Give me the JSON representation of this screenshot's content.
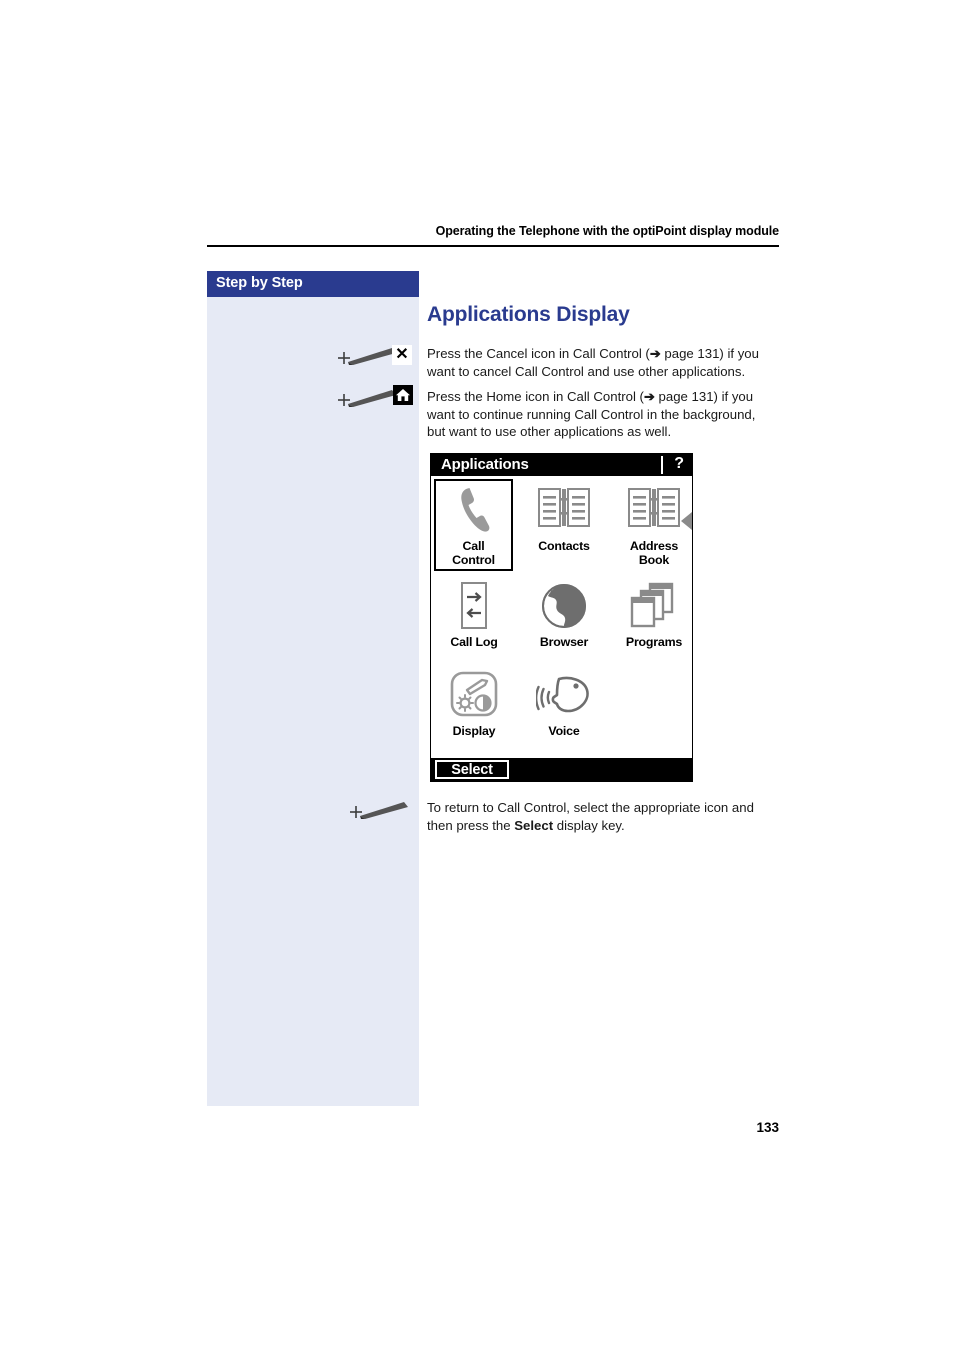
{
  "document": {
    "running_head": "Operating the Telephone with the optiPoint display module",
    "page_number": "133"
  },
  "sidebar": {
    "header_label": "Step by Step"
  },
  "main": {
    "title": "Applications Display",
    "instructions": [
      {
        "icon": "cancel-x-icon",
        "text_before": "Press the Cancel icon in Call Control (",
        "arrow": "➔",
        "text_after": " page 131) if you want to cancel Call Control and use other applications."
      },
      {
        "icon": "home-icon",
        "text_before": "Press the Home icon in Call Control (",
        "arrow": "➔",
        "text_after": " page 131) if you want to continue running Call Control in the background, but want to use other applications as well."
      }
    ],
    "closing_note": {
      "text_before": "To return to Call Control, select the appropriate icon and then press the ",
      "bold_word": "Select",
      "text_after": " display key."
    }
  },
  "phone_display": {
    "title": "Applications",
    "help_label": "?",
    "softkey_label": "Select",
    "apps": [
      {
        "label": "Call\nControl",
        "label_line1": "Call",
        "label_line2": "Control",
        "icon": "handset-icon",
        "selected": true
      },
      {
        "label": "Contacts",
        "label_line1": "Contacts",
        "label_line2": "",
        "icon": "open-book-icon",
        "selected": false
      },
      {
        "label": "Address Book",
        "label_line1": "Address",
        "label_line2": "Book",
        "icon": "open-book-icon",
        "selected": false
      },
      {
        "label": "Call Log",
        "label_line1": "Call Log",
        "label_line2": "",
        "icon": "arrows-in-out-icon",
        "selected": false
      },
      {
        "label": "Browser",
        "label_line1": "Browser",
        "label_line2": "",
        "icon": "globe-icon",
        "selected": false
      },
      {
        "label": "Programs",
        "label_line1": "Programs",
        "label_line2": "",
        "icon": "stacked-windows-icon",
        "selected": false
      },
      {
        "label": "Display",
        "label_line1": "Display",
        "label_line2": "",
        "icon": "display-settings-icon",
        "selected": false
      },
      {
        "label": "Voice",
        "label_line1": "Voice",
        "label_line2": "",
        "icon": "speaking-head-icon",
        "selected": false
      }
    ]
  },
  "colors": {
    "accent_navy": "#2a3b8f",
    "sidebar_fill": "#e6eaf5",
    "icon_gray": "#808080",
    "screen_black": "#000000"
  }
}
